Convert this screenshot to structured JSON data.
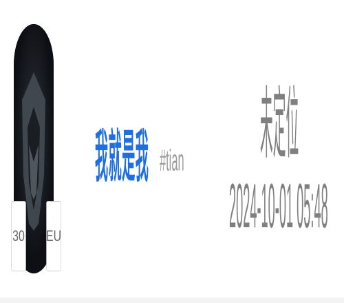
{
  "profile": {
    "avatar": {
      "icon": "avatar-icon",
      "badge_left": "30",
      "badge_right": "EU"
    },
    "nickname": "我就是我",
    "tag": "#tian",
    "location": "未定位",
    "timestamp": "2024-10-01 05:48"
  },
  "colors": {
    "nickname": "#1f6fe0",
    "secondary_text": "#7f7f7f",
    "avatar_bg": "#0d0f14"
  }
}
